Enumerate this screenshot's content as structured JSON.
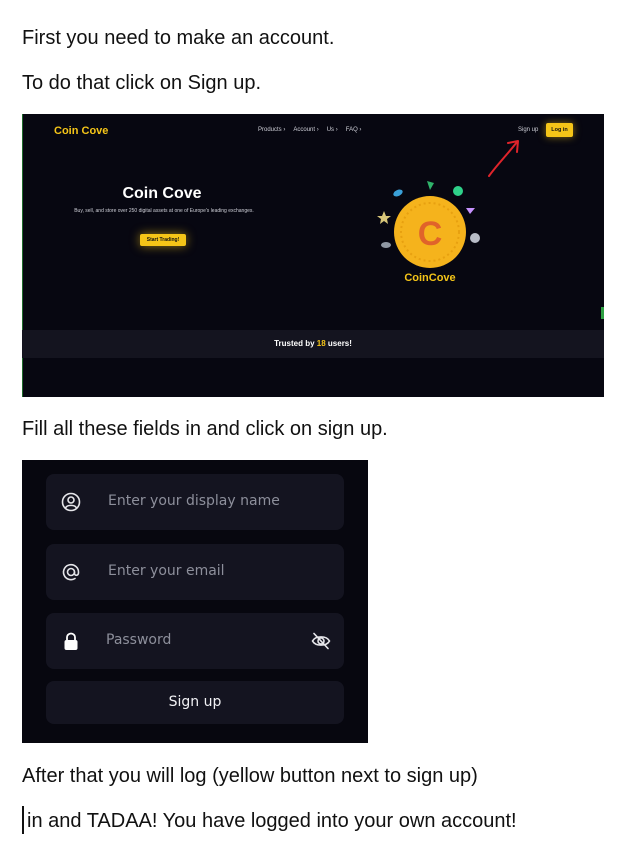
{
  "paragraphs": {
    "p1": "First you need to make an account.",
    "p2": "To do that click on Sign up.",
    "p3": "Fill all these fields in and click on sign up.",
    "p4": "After that you will log (yellow button next to sign up)",
    "p5": "in and TADAA! You have logged into your own account!"
  },
  "screenshot1": {
    "logo": "Coin Cove",
    "nav": [
      "Products",
      "Account",
      "Us",
      "FAQ"
    ],
    "signup_link": "Sign up",
    "login_button": "Log in",
    "hero_title": "Coin Cove",
    "hero_subtitle": "Buy, sell, and store over 250 digital assets at one of Europe's leading exchanges.",
    "start_button": "Start Trading!",
    "coin_letter": "C",
    "coin_label": "CoinCove",
    "trusted_prefix": "Trusted by",
    "trusted_count": "18",
    "trusted_suffix": "users!",
    "colors": {
      "accent": "#f5c518",
      "background": "#070711",
      "arrow": "#e0242b"
    }
  },
  "screenshot2": {
    "display_name_placeholder": "Enter your display name",
    "email_placeholder": "Enter your email",
    "password_placeholder": "Password",
    "signup_button": "Sign up",
    "icons": [
      "user-circle-icon",
      "at-sign-icon",
      "lock-icon",
      "eye-off-icon"
    ]
  }
}
